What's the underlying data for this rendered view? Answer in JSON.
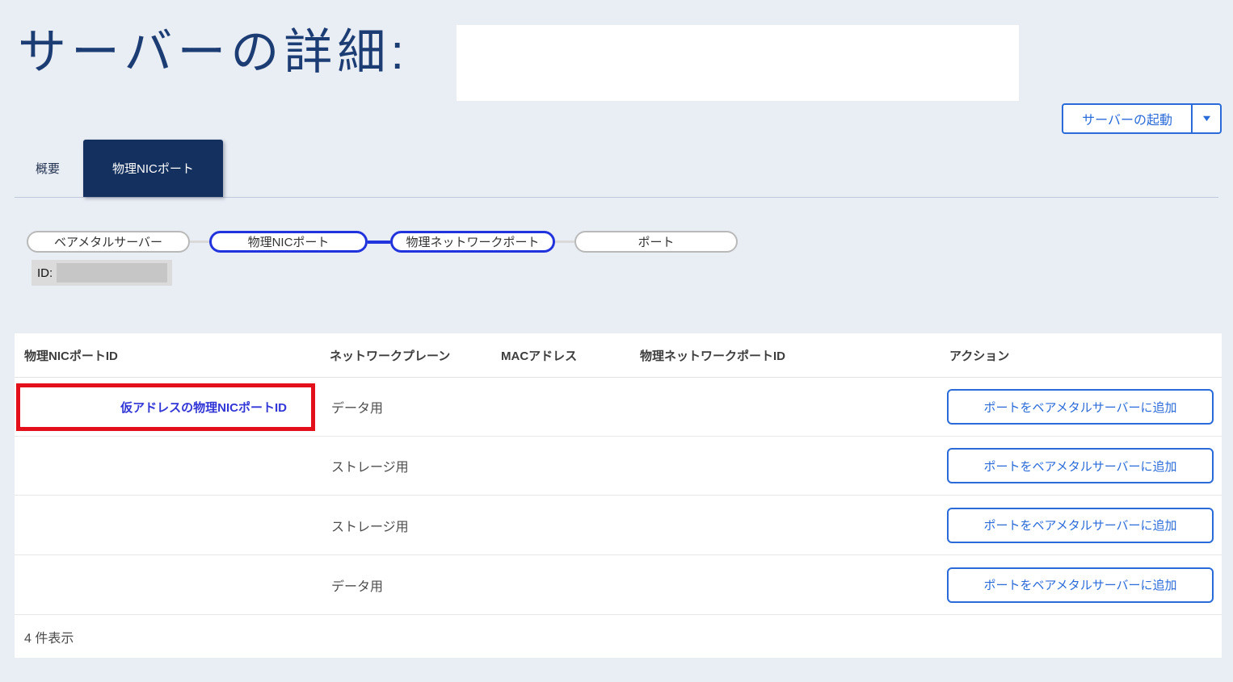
{
  "header": {
    "title": "サーバーの詳細:",
    "start_button_label": "サーバーの起動"
  },
  "tabs": [
    {
      "label": "概要",
      "active": false
    },
    {
      "label": "物理NICポート",
      "active": true
    }
  ],
  "flow": {
    "nodes": [
      {
        "label": "ベアメタルサーバー",
        "active": false
      },
      {
        "label": "物理NICポート",
        "active": true
      },
      {
        "label": "物理ネットワークポート",
        "active": true
      },
      {
        "label": "ポート",
        "active": false
      }
    ],
    "id_label": "ID:"
  },
  "table": {
    "headers": [
      "物理NICポートID",
      "ネットワークプレーン",
      "MACアドレス",
      "物理ネットワークポートID",
      "アクション"
    ],
    "rows": [
      {
        "nic_port_id": "仮アドレスの物理NICポートID",
        "plane": "データ用",
        "mac": "",
        "network_port_id": "",
        "action": "ポートをベアメタルサーバーに追加",
        "highlighted": true
      },
      {
        "nic_port_id": "",
        "plane": "ストレージ用",
        "mac": "",
        "network_port_id": "",
        "action": "ポートをベアメタルサーバーに追加",
        "highlighted": false
      },
      {
        "nic_port_id": "",
        "plane": "ストレージ用",
        "mac": "",
        "network_port_id": "",
        "action": "ポートをベアメタルサーバーに追加",
        "highlighted": false
      },
      {
        "nic_port_id": "",
        "plane": "データ用",
        "mac": "",
        "network_port_id": "",
        "action": "ポートをベアメタルサーバーに追加",
        "highlighted": false
      }
    ],
    "footer": "4 件表示"
  },
  "icons": {
    "dropdown": "▼"
  },
  "colors": {
    "page_background": "#e9edf4",
    "title_navy": "#1c3c74",
    "active_tab_navy": "#14305e",
    "accent_blue": "#2b6bd9",
    "flow_active_blue": "#2133dd",
    "link_blue": "#3236d6",
    "highlight_red": "#e3101c"
  }
}
